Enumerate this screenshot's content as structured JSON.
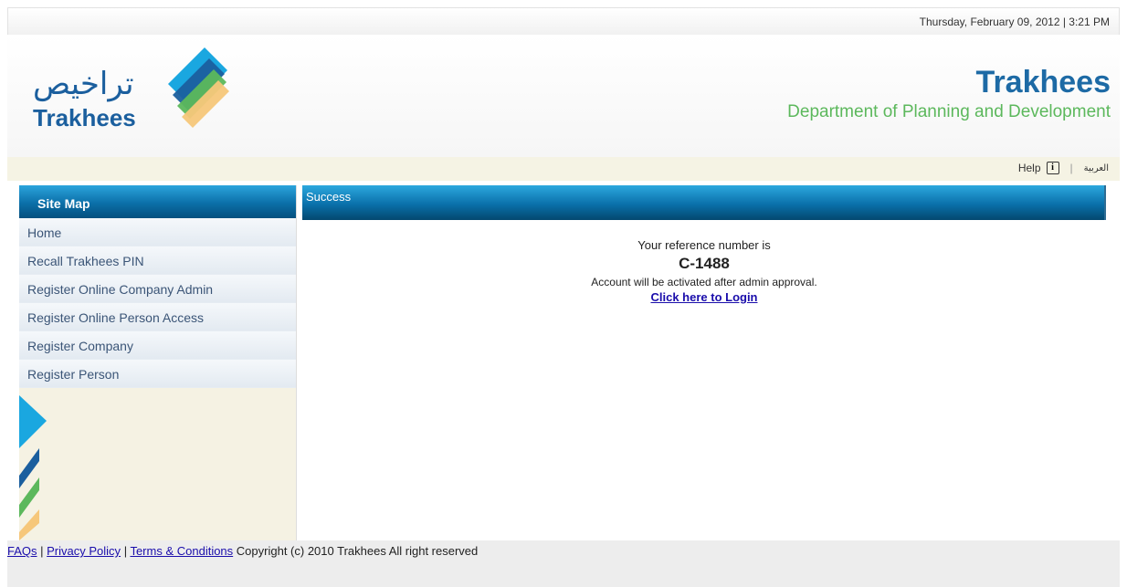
{
  "header": {
    "datetime": "Thursday, February 09, 2012 | 3:21 PM",
    "logo_arabic": "تراخيص",
    "logo_english": "Trakhees",
    "brand_title": "Trakhees",
    "brand_subtitle": "Department of Planning and Development"
  },
  "utility": {
    "help_label": "Help",
    "separator": "|",
    "arabic_label": "العربية"
  },
  "sidebar": {
    "title": "Site Map",
    "items": [
      {
        "label": "Home"
      },
      {
        "label": "Recall Trakhees PIN"
      },
      {
        "label": "Register Online Company Admin"
      },
      {
        "label": "Register Online Person Access"
      },
      {
        "label": "Register Company"
      },
      {
        "label": "Register Person"
      }
    ]
  },
  "main": {
    "bar_title": "Success",
    "ref_intro": "Your reference number is",
    "ref_number": "C-1488",
    "activation_note": "Account will be activated after admin approval.",
    "login_link": "Click here to Login"
  },
  "footer": {
    "faqs": "FAQs",
    "privacy": "Privacy Policy",
    "terms": "Terms & Conditions",
    "copyright": "Copyright (c) 2010 Trakhees All right reserved"
  },
  "colors": {
    "brand_blue": "#1d6aa5",
    "brand_green": "#5cb85c",
    "accent_cyan": "#1aa7e0"
  }
}
